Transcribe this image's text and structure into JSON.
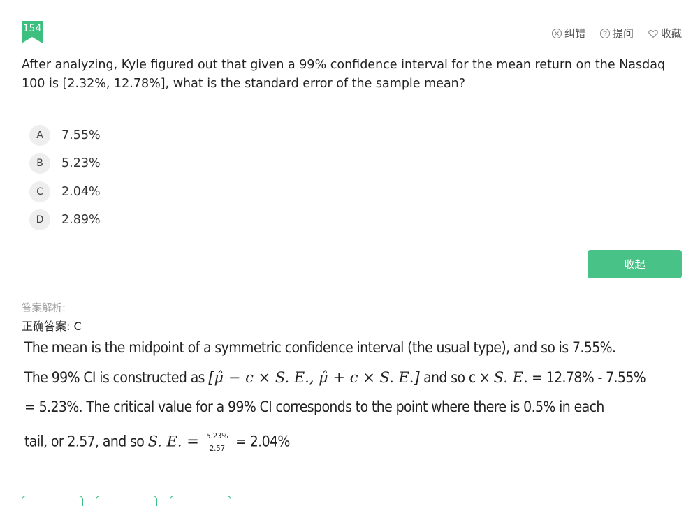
{
  "question": {
    "number": "154",
    "text": "After analyzing, Kyle figured out that given a 99% confidence interval for the mean return on the Nasdaq 100 is [2.32%, 12.78%], what is the standard error of the sample mean?"
  },
  "header_actions": [
    {
      "label": "纠错",
      "icon": "error-circle-icon"
    },
    {
      "label": "提问",
      "icon": "question-circle-icon"
    },
    {
      "label": "收藏",
      "icon": "heart-icon"
    }
  ],
  "options": [
    {
      "letter": "A",
      "text": "7.55%"
    },
    {
      "letter": "B",
      "text": "5.23%"
    },
    {
      "letter": "C",
      "text": "2.04%"
    },
    {
      "letter": "D",
      "text": "2.89%"
    }
  ],
  "collapse_button": "收起",
  "analysis": {
    "label": "答案解析:",
    "correct_answer": "正确答案: C",
    "line1": "The mean is the midpoint of a symmetric confidence interval (the usual type), and so is 7.55%.",
    "line2_a": "The 99% CI is constructed as",
    "line2_formula": "[μ̂ − c × S. E., μ̂ + c × S. E.]",
    "line2_b": "and so c ×",
    "line2_se": "S. E.",
    "line2_c": "= 12.78% - 7.55%",
    "line3": "= 5.23%. The critical value for a 99% CI corresponds to the point where there is 0.5% in each",
    "line4_a": "tail, or 2.57, and so",
    "line4_se": "S. E. =",
    "frac_num": "5.23%",
    "frac_den": "2.57",
    "line4_b": "= 2.04%"
  },
  "colors": {
    "accent": "#48c286",
    "badge": "#3cbf7f"
  }
}
